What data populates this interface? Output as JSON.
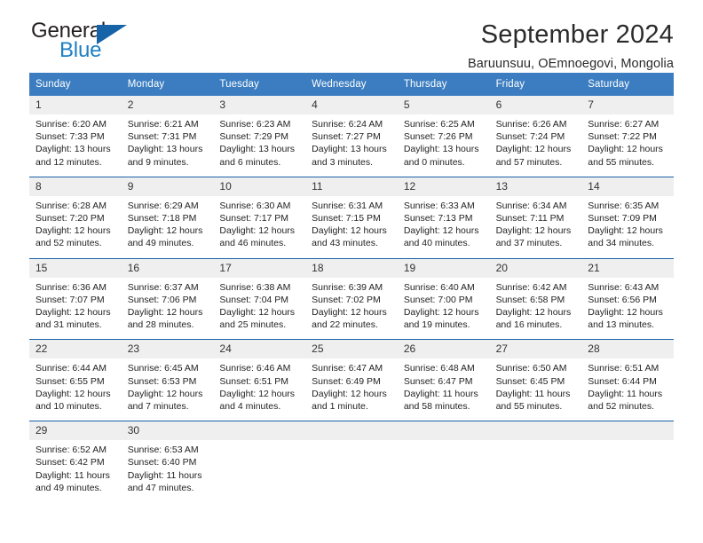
{
  "brand": {
    "name_part1": "General",
    "name_part2": "Blue",
    "accent_color": "#1763a8",
    "blue_text_color": "#1e7fc4"
  },
  "header": {
    "title": "September 2024",
    "subtitle": "Baruunsuu, OEmnoegovi, Mongolia"
  },
  "calendar": {
    "header_bg": "#3b7dc0",
    "row_border_color": "#1763a8",
    "daynum_bg": "#efefef",
    "weekdays": [
      "Sunday",
      "Monday",
      "Tuesday",
      "Wednesday",
      "Thursday",
      "Friday",
      "Saturday"
    ],
    "weeks": [
      [
        {
          "day": "1",
          "sunrise": "Sunrise: 6:20 AM",
          "sunset": "Sunset: 7:33 PM",
          "daylight": "Daylight: 13 hours and 12 minutes."
        },
        {
          "day": "2",
          "sunrise": "Sunrise: 6:21 AM",
          "sunset": "Sunset: 7:31 PM",
          "daylight": "Daylight: 13 hours and 9 minutes."
        },
        {
          "day": "3",
          "sunrise": "Sunrise: 6:23 AM",
          "sunset": "Sunset: 7:29 PM",
          "daylight": "Daylight: 13 hours and 6 minutes."
        },
        {
          "day": "4",
          "sunrise": "Sunrise: 6:24 AM",
          "sunset": "Sunset: 7:27 PM",
          "daylight": "Daylight: 13 hours and 3 minutes."
        },
        {
          "day": "5",
          "sunrise": "Sunrise: 6:25 AM",
          "sunset": "Sunset: 7:26 PM",
          "daylight": "Daylight: 13 hours and 0 minutes."
        },
        {
          "day": "6",
          "sunrise": "Sunrise: 6:26 AM",
          "sunset": "Sunset: 7:24 PM",
          "daylight": "Daylight: 12 hours and 57 minutes."
        },
        {
          "day": "7",
          "sunrise": "Sunrise: 6:27 AM",
          "sunset": "Sunset: 7:22 PM",
          "daylight": "Daylight: 12 hours and 55 minutes."
        }
      ],
      [
        {
          "day": "8",
          "sunrise": "Sunrise: 6:28 AM",
          "sunset": "Sunset: 7:20 PM",
          "daylight": "Daylight: 12 hours and 52 minutes."
        },
        {
          "day": "9",
          "sunrise": "Sunrise: 6:29 AM",
          "sunset": "Sunset: 7:18 PM",
          "daylight": "Daylight: 12 hours and 49 minutes."
        },
        {
          "day": "10",
          "sunrise": "Sunrise: 6:30 AM",
          "sunset": "Sunset: 7:17 PM",
          "daylight": "Daylight: 12 hours and 46 minutes."
        },
        {
          "day": "11",
          "sunrise": "Sunrise: 6:31 AM",
          "sunset": "Sunset: 7:15 PM",
          "daylight": "Daylight: 12 hours and 43 minutes."
        },
        {
          "day": "12",
          "sunrise": "Sunrise: 6:33 AM",
          "sunset": "Sunset: 7:13 PM",
          "daylight": "Daylight: 12 hours and 40 minutes."
        },
        {
          "day": "13",
          "sunrise": "Sunrise: 6:34 AM",
          "sunset": "Sunset: 7:11 PM",
          "daylight": "Daylight: 12 hours and 37 minutes."
        },
        {
          "day": "14",
          "sunrise": "Sunrise: 6:35 AM",
          "sunset": "Sunset: 7:09 PM",
          "daylight": "Daylight: 12 hours and 34 minutes."
        }
      ],
      [
        {
          "day": "15",
          "sunrise": "Sunrise: 6:36 AM",
          "sunset": "Sunset: 7:07 PM",
          "daylight": "Daylight: 12 hours and 31 minutes."
        },
        {
          "day": "16",
          "sunrise": "Sunrise: 6:37 AM",
          "sunset": "Sunset: 7:06 PM",
          "daylight": "Daylight: 12 hours and 28 minutes."
        },
        {
          "day": "17",
          "sunrise": "Sunrise: 6:38 AM",
          "sunset": "Sunset: 7:04 PM",
          "daylight": "Daylight: 12 hours and 25 minutes."
        },
        {
          "day": "18",
          "sunrise": "Sunrise: 6:39 AM",
          "sunset": "Sunset: 7:02 PM",
          "daylight": "Daylight: 12 hours and 22 minutes."
        },
        {
          "day": "19",
          "sunrise": "Sunrise: 6:40 AM",
          "sunset": "Sunset: 7:00 PM",
          "daylight": "Daylight: 12 hours and 19 minutes."
        },
        {
          "day": "20",
          "sunrise": "Sunrise: 6:42 AM",
          "sunset": "Sunset: 6:58 PM",
          "daylight": "Daylight: 12 hours and 16 minutes."
        },
        {
          "day": "21",
          "sunrise": "Sunrise: 6:43 AM",
          "sunset": "Sunset: 6:56 PM",
          "daylight": "Daylight: 12 hours and 13 minutes."
        }
      ],
      [
        {
          "day": "22",
          "sunrise": "Sunrise: 6:44 AM",
          "sunset": "Sunset: 6:55 PM",
          "daylight": "Daylight: 12 hours and 10 minutes."
        },
        {
          "day": "23",
          "sunrise": "Sunrise: 6:45 AM",
          "sunset": "Sunset: 6:53 PM",
          "daylight": "Daylight: 12 hours and 7 minutes."
        },
        {
          "day": "24",
          "sunrise": "Sunrise: 6:46 AM",
          "sunset": "Sunset: 6:51 PM",
          "daylight": "Daylight: 12 hours and 4 minutes."
        },
        {
          "day": "25",
          "sunrise": "Sunrise: 6:47 AM",
          "sunset": "Sunset: 6:49 PM",
          "daylight": "Daylight: 12 hours and 1 minute."
        },
        {
          "day": "26",
          "sunrise": "Sunrise: 6:48 AM",
          "sunset": "Sunset: 6:47 PM",
          "daylight": "Daylight: 11 hours and 58 minutes."
        },
        {
          "day": "27",
          "sunrise": "Sunrise: 6:50 AM",
          "sunset": "Sunset: 6:45 PM",
          "daylight": "Daylight: 11 hours and 55 minutes."
        },
        {
          "day": "28",
          "sunrise": "Sunrise: 6:51 AM",
          "sunset": "Sunset: 6:44 PM",
          "daylight": "Daylight: 11 hours and 52 minutes."
        }
      ],
      [
        {
          "day": "29",
          "sunrise": "Sunrise: 6:52 AM",
          "sunset": "Sunset: 6:42 PM",
          "daylight": "Daylight: 11 hours and 49 minutes."
        },
        {
          "day": "30",
          "sunrise": "Sunrise: 6:53 AM",
          "sunset": "Sunset: 6:40 PM",
          "daylight": "Daylight: 11 hours and 47 minutes."
        },
        {
          "day": "",
          "sunrise": "",
          "sunset": "",
          "daylight": ""
        },
        {
          "day": "",
          "sunrise": "",
          "sunset": "",
          "daylight": ""
        },
        {
          "day": "",
          "sunrise": "",
          "sunset": "",
          "daylight": ""
        },
        {
          "day": "",
          "sunrise": "",
          "sunset": "",
          "daylight": ""
        },
        {
          "day": "",
          "sunrise": "",
          "sunset": "",
          "daylight": ""
        }
      ]
    ]
  }
}
